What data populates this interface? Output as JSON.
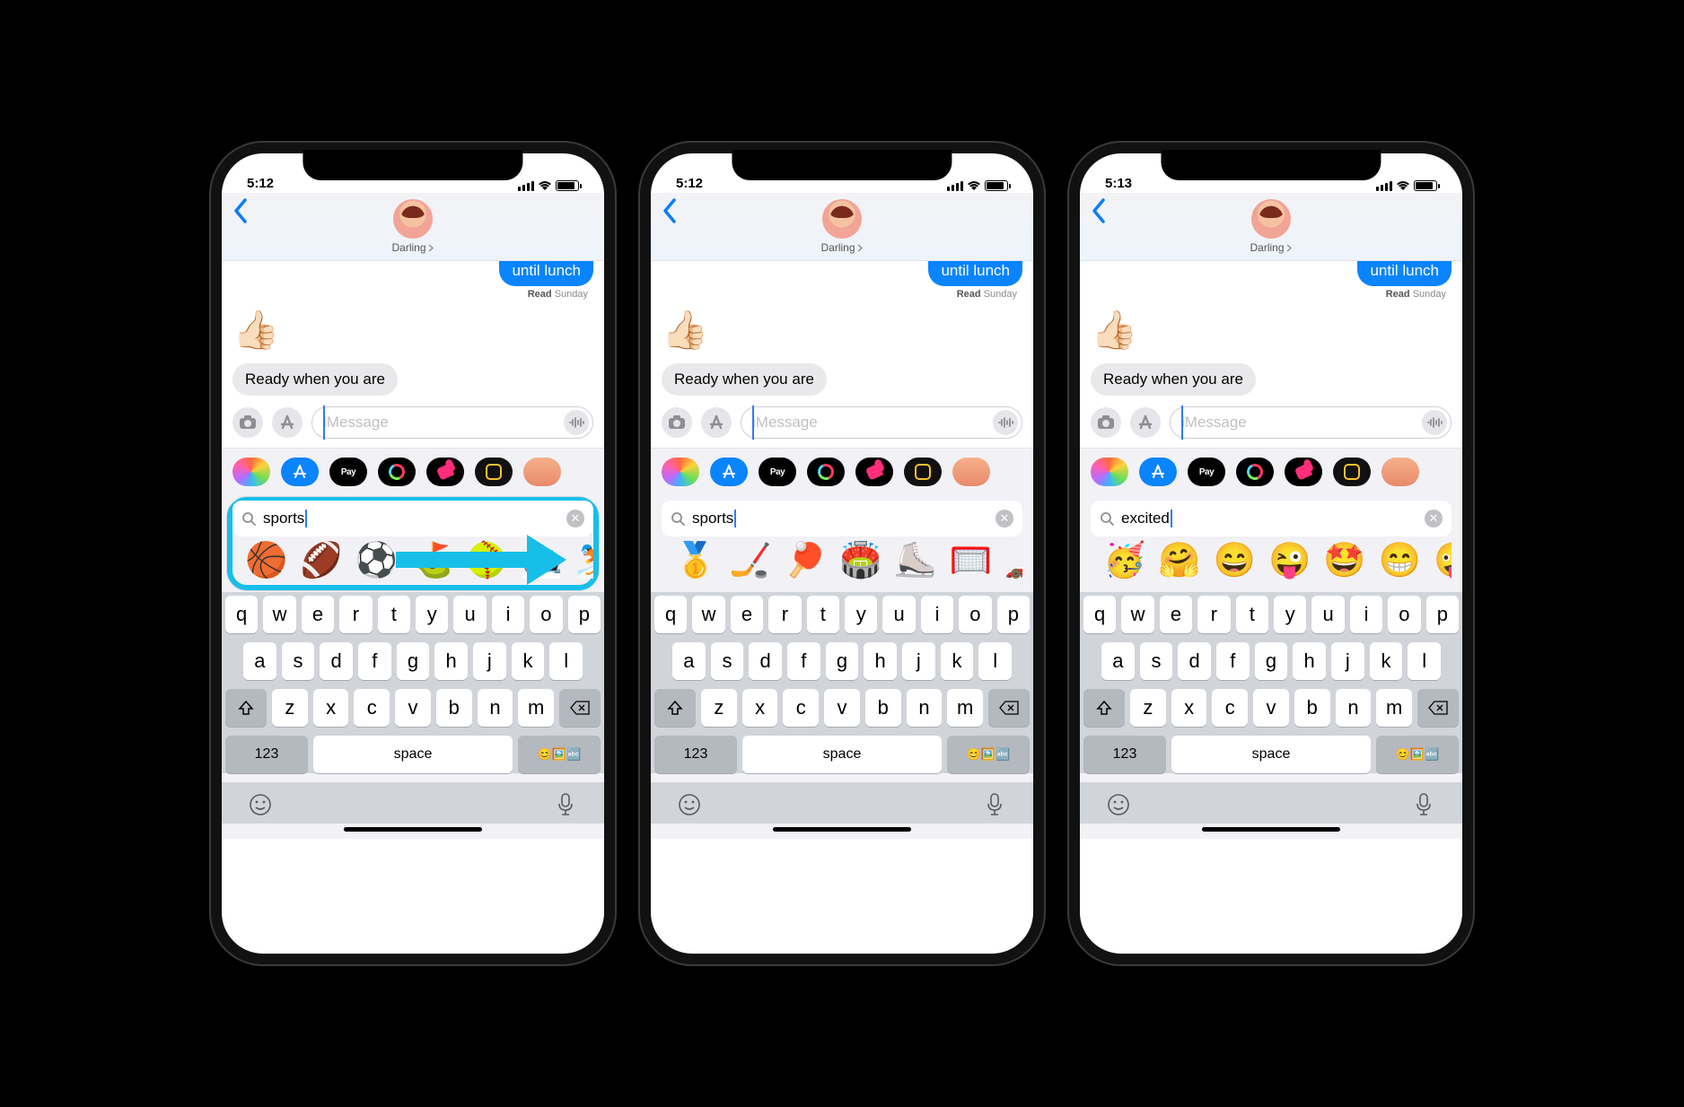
{
  "phones": [
    {
      "time": "5:12",
      "contact": "Darling",
      "sent_text": "until lunch",
      "read_prefix": "Read",
      "read_when": "Sunday",
      "thumbs": "👍🏻",
      "recv_text": "Ready when you are",
      "placeholder": "iMessage",
      "apay": "Pay",
      "search_query": "sports",
      "highlight": true,
      "emojis": [
        "🏀",
        "🏈",
        "⚽",
        "⛳",
        "🥎",
        "🎿",
        "⛷️"
      ]
    },
    {
      "time": "5:12",
      "contact": "Darling",
      "sent_text": "until lunch",
      "read_prefix": "Read",
      "read_when": "Sunday",
      "thumbs": "👍🏻",
      "recv_text": "Ready when you are",
      "placeholder": "iMessage",
      "apay": "Pay",
      "search_query": "sports",
      "highlight": false,
      "emojis": [
        "🥇",
        "🏒",
        "🏓",
        "🏟️",
        "⛸️",
        "🥅",
        "🏎️"
      ]
    },
    {
      "time": "5:13",
      "contact": "Darling",
      "sent_text": "until lunch",
      "read_prefix": "Read",
      "read_when": "Sunday",
      "thumbs": "👍🏻",
      "recv_text": "Ready when you are",
      "placeholder": "iMessage",
      "apay": "Pay",
      "search_query": "excited",
      "highlight": false,
      "emojis": [
        "🥳",
        "🤗",
        "😄",
        "😜",
        "🤩",
        "😁",
        "🤪"
      ]
    }
  ],
  "keyboard": {
    "row1": [
      "q",
      "w",
      "e",
      "r",
      "t",
      "y",
      "u",
      "i",
      "o",
      "p"
    ],
    "row2": [
      "a",
      "s",
      "d",
      "f",
      "g",
      "h",
      "j",
      "k",
      "l"
    ],
    "row3": [
      "z",
      "x",
      "c",
      "v",
      "b",
      "n",
      "m"
    ],
    "numkey": "123",
    "space": "space"
  }
}
